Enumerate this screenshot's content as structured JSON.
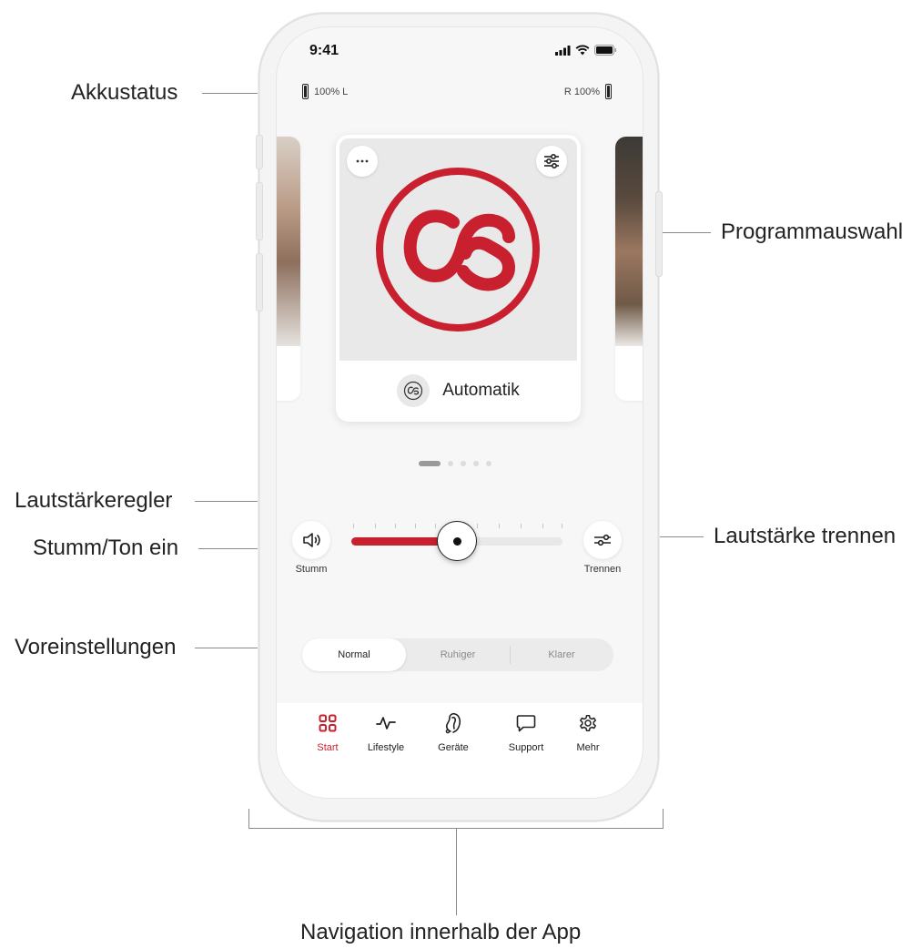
{
  "annotations": {
    "battery_status": "Akkustatus",
    "program_selection": "Programmauswahl",
    "volume_control": "Lautstärkeregler",
    "mute_unmute": "Stumm/Ton ein",
    "split_volume": "Lautstärke trennen",
    "presets": "Voreinstellungen",
    "navigation": "Navigation innerhalb der App"
  },
  "status_bar": {
    "time": "9:41"
  },
  "battery": {
    "left": {
      "percent": "100%",
      "side": "L"
    },
    "right": {
      "percent": "100%",
      "side": "R"
    }
  },
  "program": {
    "current_name": "Automatik",
    "more_icon": "ellipsis-icon",
    "settings_icon": "sliders-icon",
    "logo_icon": "automatic-program-logo",
    "carousel_pages": 5,
    "carousel_active_index": 0
  },
  "volume": {
    "mute_label": "Stumm",
    "split_label": "Trennen",
    "level": 0.5
  },
  "presets": {
    "options": [
      "Normal",
      "Ruhiger",
      "Klarer"
    ],
    "selected": "Normal"
  },
  "nav": {
    "items": [
      {
        "label": "Start",
        "icon": "grid-icon",
        "active": true
      },
      {
        "label": "Lifestyle",
        "icon": "activity-icon",
        "active": false
      },
      {
        "label": "Geräte",
        "icon": "hearing-aid-icon",
        "active": false
      },
      {
        "label": "Support",
        "icon": "chat-bubble-icon",
        "active": false
      },
      {
        "label": "Mehr",
        "icon": "gear-icon",
        "active": false
      }
    ]
  },
  "colors": {
    "accent": "#c8202f",
    "background": "#f7f7f7"
  }
}
